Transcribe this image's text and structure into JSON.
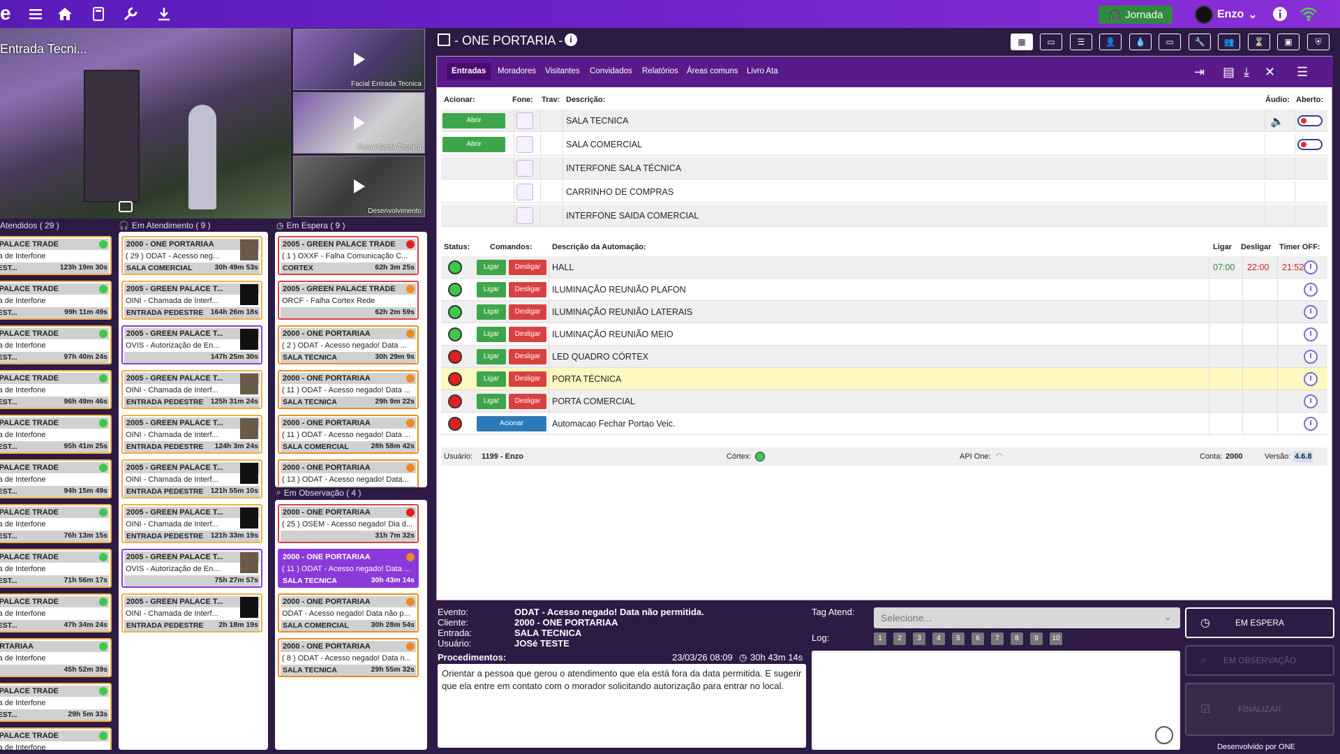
{
  "topbar": {
    "jornada": "Jornada",
    "user": "Enzo"
  },
  "camera": {
    "main_label": "Entrada Tecni...",
    "thumbs": [
      "Facial Entrada Tecnica",
      "Facial Saida Tecnica",
      "Desenvolvimento"
    ]
  },
  "columns": {
    "atendidos": "Atendidos ( 29 )",
    "em_atendimento": "Em Atendimento ( 9 )",
    "em_espera": "Em Espera ( 9 )",
    "em_observacao": "Em Observação ( 4 )"
  },
  "atendidos_cards": [
    {
      "l1": "REEN PALACE TRADE",
      "l2": "hamada de Interfone",
      "l3": "A PEDEST...",
      "t": "123h 19m 30s"
    },
    {
      "l1": "REEN PALACE TRADE",
      "l2": "hamada de Interfone",
      "l3": "A PEDEST...",
      "t": "99h 11m 49s"
    },
    {
      "l1": "REEN PALACE TRADE",
      "l2": "hamada de Interfone",
      "l3": "A PEDEST...",
      "t": "97h 40m 24s"
    },
    {
      "l1": "REEN PALACE TRADE",
      "l2": "hamada de Interfone",
      "l3": "A PEDEST...",
      "t": "96h 49m 46s"
    },
    {
      "l1": "REEN PALACE TRADE",
      "l2": "hamada de Interfone",
      "l3": "A PEDEST...",
      "t": "95h 41m 25s"
    },
    {
      "l1": "REEN PALACE TRADE",
      "l2": "hamada de Interfone",
      "l3": "A PEDEST...",
      "t": "94h 15m 49s"
    },
    {
      "l1": "REEN PALACE TRADE",
      "l2": "hamada de Interfone",
      "l3": "A PEDEST...",
      "t": "76h 13m 15s"
    },
    {
      "l1": "REEN PALACE TRADE",
      "l2": "hamada de Interfone",
      "l3": "A PEDEST...",
      "t": "71h 56m 17s"
    },
    {
      "l1": "REEN PALACE TRADE",
      "l2": "hamada de Interfone",
      "l3": "A PEDEST...",
      "t": "47h 34m 24s"
    },
    {
      "l1": "NE PORTARIAA",
      "l2": "hamada de Interfone",
      "l3": "",
      "t": "45h 52m 39s"
    },
    {
      "l1": "REEN PALACE TRADE",
      "l2": "hamada de Interfone",
      "l3": "A PEDEST...",
      "t": "29h 5m 33s"
    },
    {
      "l1": "REEN PALACE TRADE",
      "l2": "hamada de Interfone",
      "l3": "",
      "t": ""
    }
  ],
  "atendimento_cards": [
    {
      "l1": "2000 - ONE PORTARIAA",
      "l2": "( 29 ) ODAT - Acesso neg...",
      "l3": "SALA COMERCIAL",
      "t": "30h 49m 53s"
    },
    {
      "l1": "2005 - GREEN PALACE T...",
      "l2": "OINI - Chamada de Interf...",
      "l3": "ENTRADA PEDESTRE",
      "t": "164h 26m 18s"
    },
    {
      "l1": "2005 - GREEN PALACE T...",
      "l2": "OVIS - Autorização de En...",
      "l3": "",
      "t": "147h 25m 30s"
    },
    {
      "l1": "2005 - GREEN PALACE T...",
      "l2": "OINI - Chamada de Interf...",
      "l3": "ENTRADA PEDESTRE",
      "t": "125h 31m 24s"
    },
    {
      "l1": "2005 - GREEN PALACE T...",
      "l2": "OINI - Chamada de Interf...",
      "l3": "ENTRADA PEDESTRE",
      "t": "124h 3m 24s"
    },
    {
      "l1": "2005 - GREEN PALACE T...",
      "l2": "OINI - Chamada de Interf...",
      "l3": "ENTRADA PEDESTRE",
      "t": "121h 55m 10s"
    },
    {
      "l1": "2005 - GREEN PALACE T...",
      "l2": "OINI - Chamada de Interf...",
      "l3": "ENTRADA PEDESTRE",
      "t": "121h 33m 19s"
    },
    {
      "l1": "2005 - GREEN PALACE T...",
      "l2": "OVIS - Autorização de En...",
      "l3": "",
      "t": "75h 27m 57s"
    },
    {
      "l1": "2005 - GREEN PALACE T...",
      "l2": "OINI - Chamada de Interf...",
      "l3": "ENTRADA PEDESTRE",
      "t": "2h 18m 19s"
    }
  ],
  "espera_cards": [
    {
      "l1": "2005 - GREEN PALACE TRADE",
      "l2": "( 1 ) OXXF - Falha Comunicação C...",
      "l3": "CORTEX",
      "t": "62h 3m 25s"
    },
    {
      "l1": "2005 - GREEN PALACE TRADE",
      "l2": "ORCF - Falha Cortex Rede",
      "l3": "",
      "t": "62h 2m 59s"
    },
    {
      "l1": "2000 - ONE PORTARIAA",
      "l2": "( 2 ) ODAT - Acesso negado! Data ...",
      "l3": "SALA TECNICA",
      "t": "30h 29m 9s"
    },
    {
      "l1": "2000 - ONE PORTARIAA",
      "l2": "( 11 ) ODAT - Acesso negado! Data ...",
      "l3": "SALA TECNICA",
      "t": "29h 9m 22s"
    },
    {
      "l1": "2000 - ONE PORTARIAA",
      "l2": "( 11 ) ODAT - Acesso negado! Data ...",
      "l3": "SALA COMERCIAL",
      "t": "28h 58m 42s"
    },
    {
      "l1": "2000 - ONE PORTARIAA",
      "l2": "( 13 ) ODAT - Acesso negado! Data...",
      "l3": "",
      "t": ""
    }
  ],
  "observacao_cards": [
    {
      "l1": "2000 - ONE PORTARIAA",
      "l2": "( 25 ) OSEM - Acesso negado! Dia d...",
      "l3": "",
      "t": "31h 7m 32s"
    },
    {
      "l1": "2000 - ONE PORTARIAA",
      "l2": "( 11 ) ODAT - Acesso negado! Data ...",
      "l3": "SALA TECNICA",
      "t": "30h 43m 14s"
    },
    {
      "l1": "2000 - ONE PORTARIAA",
      "l2": "ODAT - Acesso negado! Data não p...",
      "l3": "SALA COMERCIAL",
      "t": "30h 28m 54s"
    },
    {
      "l1": "2000 - ONE PORTARIAA",
      "l2": "( 8 ) ODAT - Acesso negado! Data n...",
      "l3": "SALA TECNICA",
      "t": "29h 55m 32s"
    }
  ],
  "panel": {
    "title": "- ONE PORTARIA -",
    "tabs": [
      "Entradas",
      "Moradores",
      "Visitantes",
      "Convidados",
      "Relatórios",
      "Áreas comuns",
      "Livro Ata"
    ],
    "h_acionar": "Acionar:",
    "h_fone": "Fone:",
    "h_trav": "Trav:",
    "h_desc": "Descrição:",
    "h_audio": "Áudio:",
    "h_aberto": "Aberto:",
    "abrir": "Abrir",
    "entradas": [
      "SALA TECNICA",
      "SALA COMERCIAL",
      "INTERFONE SALA TÉCNICA",
      "CARRINHO DE COMPRAS",
      "INTERFONE SAIDA COMERCIAL"
    ],
    "h_status": "Status:",
    "h_comandos": "Comandos:",
    "h_desc_auto": "Descrição da Automação:",
    "h_ligar": "Ligar",
    "h_desligar": "Desligar",
    "h_timer": "Timer OFF:",
    "btn_ligar": "Ligar",
    "btn_desligar": "Desligar",
    "btn_acionar": "Acionar",
    "automacoes": [
      "HALL",
      "ILUMINAÇÃO REUNIÃO PLAFON",
      "ILUMINAÇÃO REUNIÃO LATERAIS",
      "ILUMINAÇÃO REUNIÃO MEIO",
      "LED QUADRO CÓRTEX",
      "PORTA TÉCNICA",
      "PORTA COMERCIAL",
      "Automacao Fechar Portao Veic."
    ],
    "hall_ligar": "07:00",
    "hall_desligar": "22:00",
    "hall_timer": "21:52",
    "footer": {
      "usuario_lbl": "Usuário:",
      "usuario": "1199 - Enzo",
      "cortex": "Córtex:",
      "api": "API One:",
      "conta_lbl": "Conta:",
      "conta": "2000",
      "versao_lbl": "Versão:",
      "versao": "4.6.8"
    }
  },
  "evento": {
    "evento_lbl": "Evento:",
    "evento": "ODAT - Acesso negado! Data não permitida.",
    "cliente_lbl": "Cliente:",
    "cliente": "2000 - ONE PORTARIAA",
    "entrada_lbl": "Entrada:",
    "entrada": "SALA TECNICA",
    "usuario_lbl": "Usuário:",
    "usuario": "JOSé TESTE",
    "proc_lbl": "Procedimentos:",
    "datetime": "23/03/26 08:09",
    "elapsed": "30h 43m 14s",
    "proc_text": "Orientar a pessoa que gerou o atendimento que ela está fora da data permitida. E sugerir que ela entre em contato com o morador solicitando autorização para entrar no local.",
    "tag_lbl": "Tag Atend:",
    "tag_placeholder": "Selecione...",
    "log_lbl": "Log:",
    "log_nums": [
      "1",
      "2",
      "3",
      "4",
      "5",
      "6",
      "7",
      "8",
      "9",
      "10"
    ]
  },
  "side_buttons": {
    "espera": "EM ESPERA",
    "observacao": "EM OBSERVAÇÃO",
    "finalizar": "FINALIZAR",
    "credit": "Desenvolvido por ONE"
  },
  "colors": {
    "green": "#3ea54a",
    "red": "#d94040",
    "orange": "#f08a20",
    "purple": "#6a22c8"
  }
}
